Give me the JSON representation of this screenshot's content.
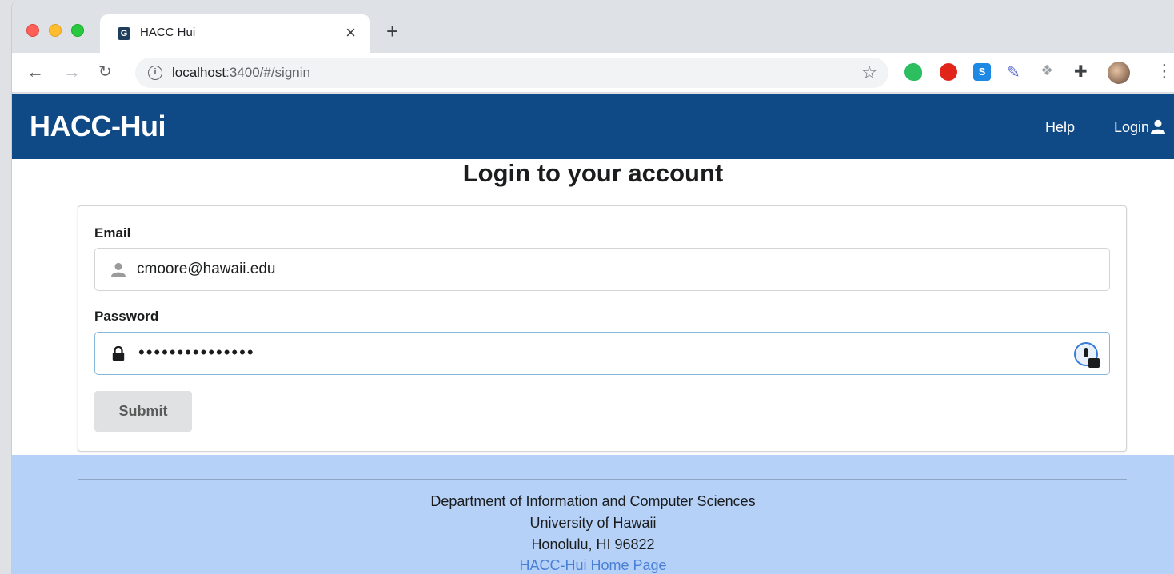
{
  "browser": {
    "tab": {
      "title": "HACC Hui",
      "favicon_icon": "hacc-favicon-icon"
    },
    "url": {
      "host": "localhost",
      "path": ":3400/#/signin"
    },
    "icons": [
      "back-arrow-icon",
      "forward-arrow-icon",
      "reload-icon",
      "info-icon",
      "star-icon",
      "evernote-icon",
      "stop-icon",
      "s-extension-icon",
      "dropper-icon",
      "dropbox-icon",
      "puzzle-icon",
      "profile-avatar",
      "menu-dots-icon"
    ]
  },
  "navbar": {
    "brand": "HACC-Hui",
    "help": "Help",
    "login": "Login",
    "bg_color": "#0f4a86"
  },
  "login": {
    "heading": "Login to your account",
    "email_label": "Email",
    "email_value": "cmoore@hawaii.edu",
    "password_label": "Password",
    "password_value": "•••••••••••••••",
    "submit": "Submit"
  },
  "footer": {
    "line1": "Department of Information and Computer Sciences",
    "line2": "University of Hawaii",
    "line3": "Honolulu, HI 96822",
    "link": "HACC-Hui Home Page",
    "bg_color": "#b5d1f7"
  }
}
